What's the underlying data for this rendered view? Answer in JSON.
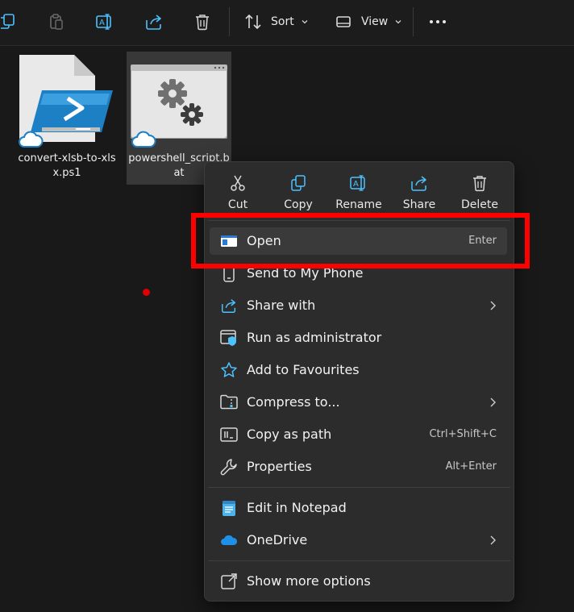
{
  "toolbar": {
    "sort_label": "Sort",
    "view_label": "View",
    "icons": [
      "copy-icon",
      "paste-icon",
      "rename-icon",
      "share-icon",
      "delete-icon",
      "sort-icon",
      "view-icon",
      "more-icon"
    ]
  },
  "files": [
    {
      "name": "convert-xlsb-to-xlsx.ps1",
      "icon": "powershell-file-icon",
      "sync": "cloud-icon"
    },
    {
      "name": "powershell_script.bat",
      "icon": "batch-file-icon",
      "sync": "cloud-icon",
      "selected": true
    }
  ],
  "menu": {
    "quick_actions": [
      {
        "label": "Cut",
        "icon": "scissors-icon"
      },
      {
        "label": "Copy",
        "icon": "copy-icon"
      },
      {
        "label": "Rename",
        "icon": "rename-icon"
      },
      {
        "label": "Share",
        "icon": "share-icon"
      },
      {
        "label": "Delete",
        "icon": "trash-icon"
      }
    ],
    "items": [
      {
        "label": "Open",
        "shortcut": "Enter",
        "icon": "open-window-icon"
      },
      {
        "label": "Send to My Phone",
        "shortcut": "",
        "icon": "phone-icon"
      },
      {
        "label": "Share with",
        "shortcut": "",
        "icon": "share-icon",
        "submenu": true
      },
      {
        "label": "Run as administrator",
        "shortcut": "",
        "icon": "shield-window-icon"
      },
      {
        "label": "Add to Favourites",
        "shortcut": "",
        "icon": "star-icon"
      },
      {
        "label": "Compress to...",
        "shortcut": "",
        "icon": "zip-folder-icon",
        "submenu": true
      },
      {
        "label": "Copy as path",
        "shortcut": "Ctrl+Shift+C",
        "icon": "path-icon"
      },
      {
        "label": "Properties",
        "shortcut": "Alt+Enter",
        "icon": "wrench-icon"
      },
      {
        "label": "Edit in Notepad",
        "shortcut": "",
        "icon": "notepad-icon"
      },
      {
        "label": "OneDrive",
        "shortcut": "",
        "icon": "onedrive-icon",
        "submenu": true
      },
      {
        "label": "Show more options",
        "shortcut": "",
        "icon": "more-options-icon"
      }
    ]
  },
  "colors": {
    "highlight": "#ff0000",
    "accent": "#4cc2ff",
    "menu_background": "#2c2c2c"
  }
}
